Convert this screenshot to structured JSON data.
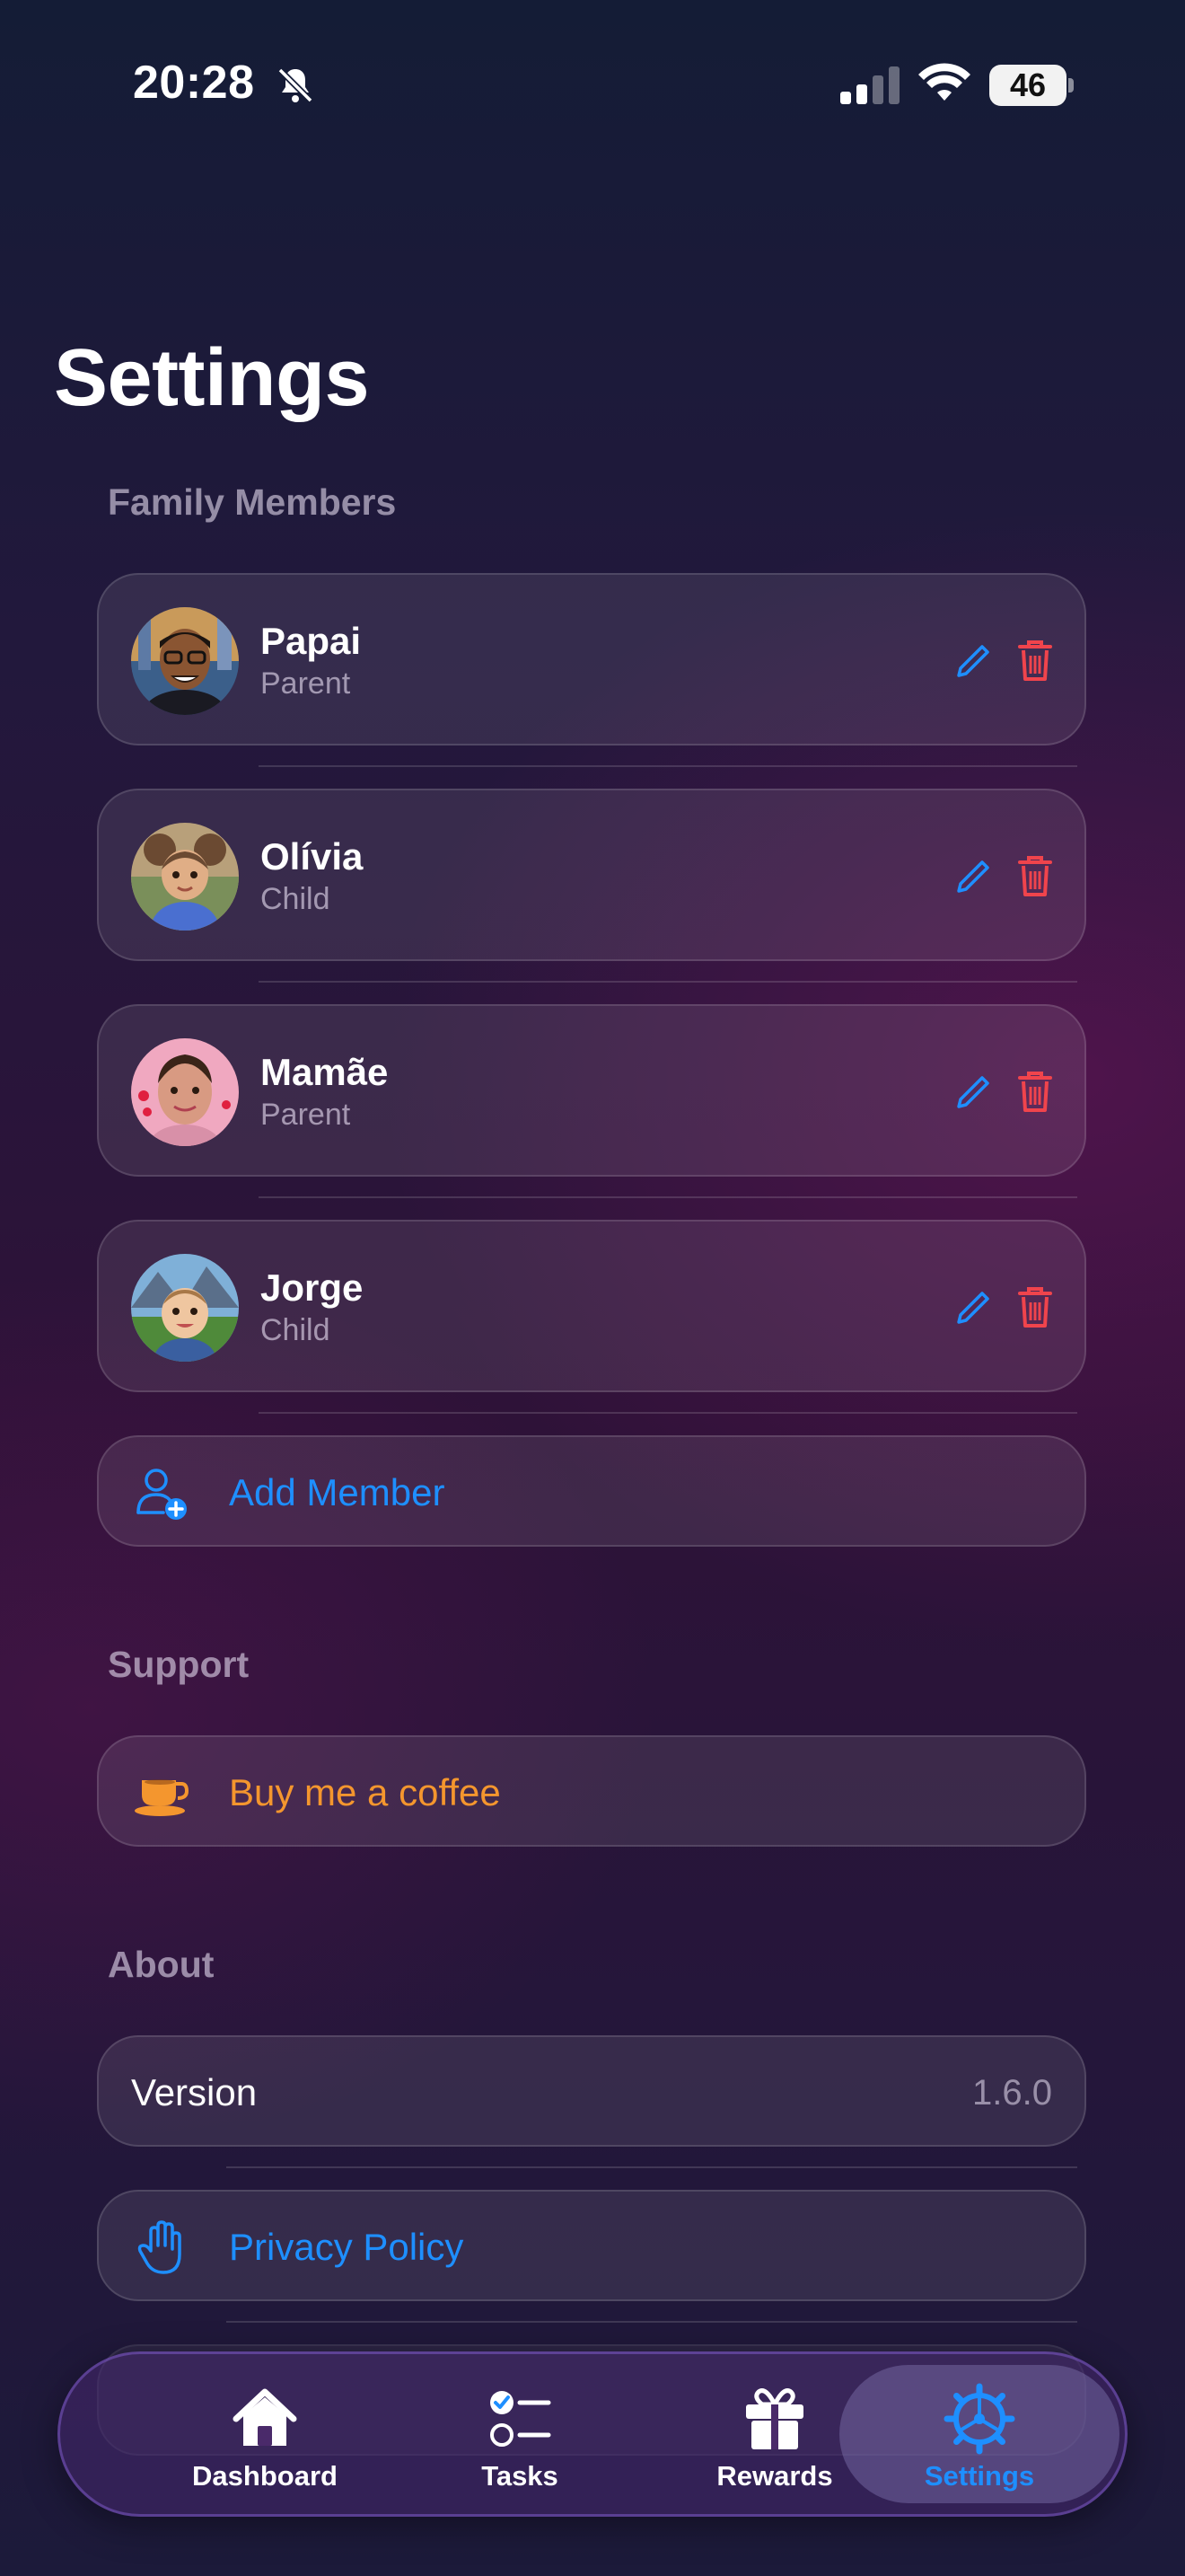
{
  "status_bar": {
    "time": "20:28",
    "battery": "46"
  },
  "page": {
    "title": "Settings"
  },
  "sections": {
    "family": "Family Members",
    "support": "Support",
    "about": "About"
  },
  "members": [
    {
      "name": "Papai",
      "role": "Parent"
    },
    {
      "name": "Olívia",
      "role": "Child"
    },
    {
      "name": "Mamãe",
      "role": "Parent"
    },
    {
      "name": "Jorge",
      "role": "Child"
    }
  ],
  "add_member": {
    "label": "Add Member"
  },
  "support": {
    "coffee_label": "Buy me a coffee"
  },
  "about": {
    "version_label": "Version",
    "version_value": "1.6.0",
    "privacy_label": "Privacy Policy"
  },
  "tabbar": {
    "tabs": [
      {
        "label": "Dashboard"
      },
      {
        "label": "Tasks"
      },
      {
        "label": "Rewards"
      },
      {
        "label": "Settings"
      }
    ],
    "active": "Settings"
  },
  "colors": {
    "accent_blue": "#1E8FFF",
    "delete_red": "#F0444C",
    "coffee_orange": "#F4962E"
  }
}
